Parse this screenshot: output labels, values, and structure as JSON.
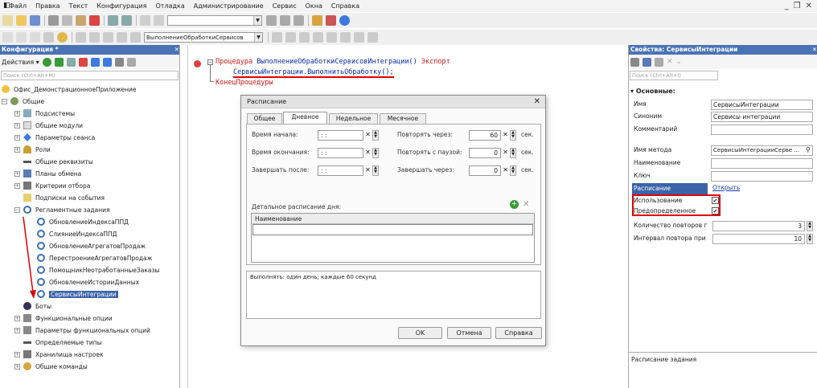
{
  "menu": [
    "Файл",
    "Правка",
    "Текст",
    "Конфигурация",
    "Отладка",
    "Администрирование",
    "Сервис",
    "Окна",
    "Справка"
  ],
  "toolbar": {
    "combo_value": "ВыполнениеОбработкиСервисов"
  },
  "config_panel": {
    "title": "Конфигурация *",
    "actions_label": "Действия ▾",
    "search_placeholder": "Поиск (Ctrl+Alt+M)",
    "tree": [
      {
        "label": "Офис_ДемонстрационноеПриложение"
      },
      {
        "label": "Общие"
      },
      {
        "label": "Подсистемы"
      },
      {
        "label": "Общие модули"
      },
      {
        "label": "Параметры сеанса"
      },
      {
        "label": "Роли"
      },
      {
        "label": "Общие реквизиты"
      },
      {
        "label": "Планы обмена"
      },
      {
        "label": "Критерии отбора"
      },
      {
        "label": "Подписки на события"
      },
      {
        "label": "Регламентные задания"
      },
      {
        "label": "ОбновлениеИндексаППД"
      },
      {
        "label": "СлияниеИндексаППД"
      },
      {
        "label": "ОбновлениеАгрегатовПродаж"
      },
      {
        "label": "ПерестроениеАгрегатовПродаж"
      },
      {
        "label": "ПомощникНеотработанныеЗаказы"
      },
      {
        "label": "ОбновлениеИсторииДанных"
      },
      {
        "label": "СервисыИнтеграции"
      },
      {
        "label": "Боты"
      },
      {
        "label": "Функциональные опции"
      },
      {
        "label": "Параметры функциональных опций"
      },
      {
        "label": "Определяемые типы"
      },
      {
        "label": "Хранилища настроек"
      },
      {
        "label": "Общие команды"
      }
    ]
  },
  "code": {
    "line1_kw": "Процедура",
    "line1_name": "ВыполнениеОбработкиСервисовИнтеграции()",
    "line1_export": "Экспорт",
    "line2": "СервисыИнтеграции.ВыполнитьОбработку();",
    "line3": "КонецПроцедуры"
  },
  "dialog": {
    "title": "Расписание",
    "tabs": [
      "Общее",
      "Дневное",
      "Недельное",
      "Месячное"
    ],
    "start_label": "Время начала:",
    "end_label": "Время окончания:",
    "finish_after_label": "Завершать после:",
    "time_value": " :  :",
    "repeat_every_label": "Повторять через:",
    "repeat_every_value": "60",
    "pause_label": "Повторять с паузой:",
    "pause_value": "0",
    "finish_in_label": "Завершать через:",
    "finish_in_value": "0",
    "sec": "сек.",
    "detail_label": "Детальное расписание дня:",
    "grid_header": "Наименование",
    "summary": "Выполнять: один день; каждые 60 секунд",
    "ok": "OK",
    "cancel": "Отмена",
    "help": "Справка"
  },
  "props_panel": {
    "title": "Свойства: СервисыИнтеграции",
    "search_placeholder": "Поиск (Ctrl+Alt+I)",
    "section": "Основные:",
    "rows": [
      {
        "label": "Имя",
        "value": "СервисыИнтеграции"
      },
      {
        "label": "Синоним",
        "value": "Сервисы интеграции"
      },
      {
        "label": "Комментарий",
        "value": ""
      },
      {
        "label": "Имя метода",
        "value": "СервисыИнтеграцииСерве ..."
      },
      {
        "label": "Наименование",
        "value": ""
      },
      {
        "label": "Ключ",
        "value": ""
      },
      {
        "label": "Расписание",
        "value": "Открыть"
      },
      {
        "label": "Использование",
        "value": "✔"
      },
      {
        "label": "Предопределенное",
        "value": "✔"
      },
      {
        "label": "Количество повторов г",
        "value": "3"
      },
      {
        "label": "Интервал повтора при",
        "value": "10"
      }
    ],
    "description": "Расписание задания"
  },
  "colors": {
    "accent": "#3c64a8",
    "code_keyword": "#d01818",
    "code_name": "#0b2ba8",
    "annotation": "#e00000"
  }
}
